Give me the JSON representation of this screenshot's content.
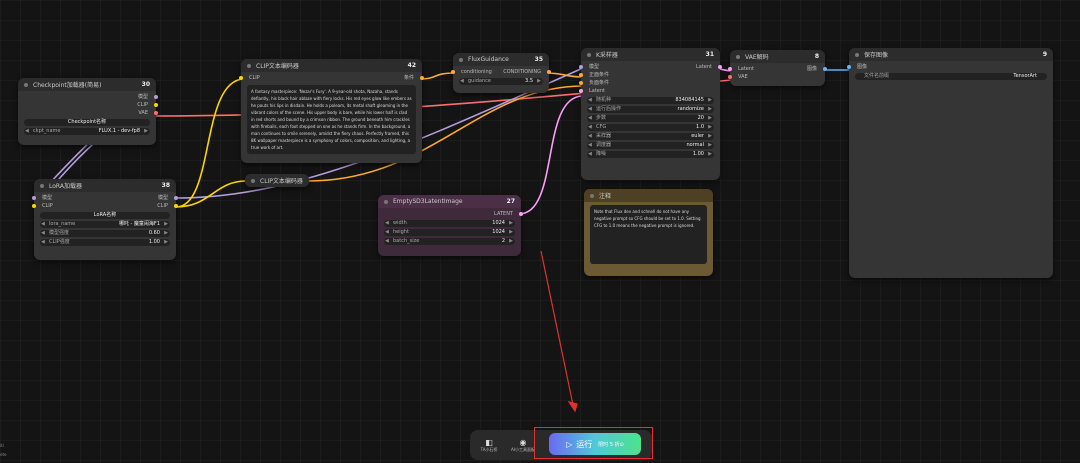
{
  "colors": {
    "model": "#b39ddb",
    "clip": "#ffd500",
    "vae": "#ff6e6e",
    "conditioning": "#ffa931",
    "latent": "#ff9cf9",
    "image": "#64b5f6",
    "annotation": "#e03030"
  },
  "nodes": {
    "checkpoint": {
      "title": "Checkpoint加载器(简易)",
      "id": "30",
      "outputs": [
        "模型",
        "CLIP",
        "VAE"
      ],
      "widget_label": "Checkpoint名称",
      "ckpt_key": "ckpt_name",
      "ckpt_value": "FLUX.1 - dev-fp8"
    },
    "lora": {
      "title": "LoRA加载器",
      "id": "38",
      "in_model": "模型",
      "in_clip": "CLIP",
      "out_model": "模型",
      "out_clip": "CLIP",
      "widget_label": "LoRA名称",
      "lora_key": "lora_name",
      "lora_value": "哪吒 - 魔童闹海F1",
      "model_strength_label": "模型强度",
      "model_strength_value": "0.60",
      "clip_strength_label": "CLIP强度",
      "clip_strength_value": "1.00"
    },
    "clip1": {
      "title": "CLIP文本编码器",
      "id": "42",
      "in_clip": "CLIP",
      "out": "条件",
      "text": "A fantasy masterpiece: 'Nezar's Fury'. A 9-year-old shota, Nazaha, stands defiantly, his black hair ablaze with fiery locks. His red eyes glow like embers as he pouts his lips in disdain. He holds a poleam, its metal shaft gleaming in the vibrant colors of the scene. His upper body is bare, while his lower half is clad in red shorts and bound by a crimson ribbon. The ground beneath him crackles with firebails, each foot stepped on one as he stands firm. In the background, a man continues to smile serenely, amidst the fiery chaos. Perfectly framed, this 8K wallpaper masterpiece is a symphony of colors, composition, and lighting, a true work of art."
    },
    "clip2": {
      "title": "CLIP文本编码器"
    },
    "flux": {
      "title": "FluxGuidance",
      "id": "35",
      "in_label": "conditioning",
      "out_label": "CONDITIONING",
      "guidance_key": "guidance",
      "guidance_value": "3.5"
    },
    "ksampler": {
      "title": "K采样器",
      "id": "31",
      "in_model": "模型",
      "in_pos": "正面条件",
      "in_neg": "负面条件",
      "in_latent": "Latent",
      "out_latent": "Latent",
      "widgets": [
        {
          "label": "随机种",
          "value": "834084145"
        },
        {
          "label": "运行后操作",
          "value": "randomize"
        },
        {
          "label": "步数",
          "value": "20"
        },
        {
          "label": "CFG",
          "value": "1.0"
        },
        {
          "label": "采样器",
          "value": "euler"
        },
        {
          "label": "调度器",
          "value": "normal"
        },
        {
          "label": "降噪",
          "value": "1.00"
        }
      ]
    },
    "vae": {
      "title": "VAE解码",
      "id": "8",
      "in_latent": "Latent",
      "in_vae": "VAE",
      "out": "图像"
    },
    "save": {
      "title": "保存图像",
      "id": "9",
      "in_image": "图像",
      "prefix_label": "文件名前缀",
      "prefix_value": "TensorArt"
    },
    "note": {
      "title": "注释",
      "text": "Note that Flux dev and schnell do not have any negative prompt so CFG should be set to 1.0. Setting CFG to 1.0 means the negative prompt is ignored."
    },
    "empty": {
      "title": "EmptySD3LatentImage",
      "id": "27",
      "out": "LATENT",
      "widgets": [
        {
          "label": "width",
          "value": "1024"
        },
        {
          "label": "height",
          "value": "1024"
        },
        {
          "label": "batch_size",
          "value": "2"
        }
      ]
    }
  },
  "bottom_bar": {
    "item1": "TA小石桥",
    "item2": "AI小工具面板",
    "run_label": "运行",
    "run_sub": "限时 5 折⊙"
  },
  "corner_tags": [
    "iti",
    "ete"
  ]
}
